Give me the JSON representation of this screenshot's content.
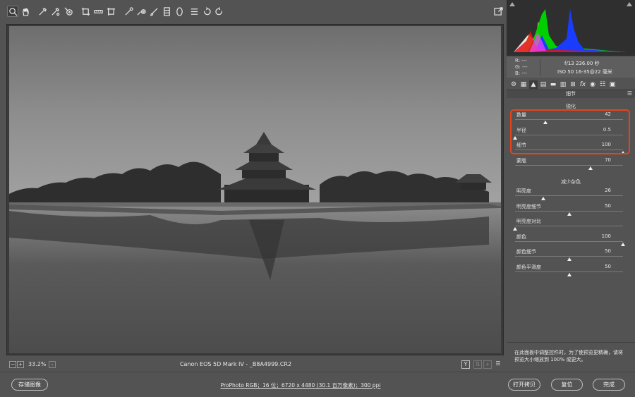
{
  "toolbar": {
    "tools": [
      "zoom-icon",
      "hand-icon",
      "white-balance-icon",
      "color-sampler-icon",
      "target-adjustment-icon",
      "crop-icon",
      "straighten-icon",
      "transform-icon",
      "spot-removal-icon",
      "red-eye-icon",
      "adjustment-brush-icon",
      "graduated-filter-icon",
      "radial-filter-icon",
      "preferences-icon",
      "rotate-ccw-icon",
      "rotate-cw-icon"
    ],
    "right_tool": "fullscreen-toggle-icon"
  },
  "status_bar": {
    "zoom": "33.2%",
    "filename": "Canon EOS 5D Mark IV -  _B8A4999.CR2"
  },
  "info": {
    "r": "R:  ---",
    "g": "G:  ---",
    "b": "B:  ---",
    "aperture_shutter": "f/13    236.00 秒",
    "iso_lens": "ISO 50    16-35@22 毫米"
  },
  "panel": {
    "header": "细节",
    "sharpen": {
      "title": "锐化",
      "amount": {
        "label": "数量",
        "value": "42",
        "level": 0.28
      },
      "radius": {
        "label": "半径",
        "value": "0.5",
        "level": 0.0
      },
      "detail": {
        "label": "细节",
        "value": "100",
        "level": 1.0
      },
      "masking": {
        "label": "蒙版",
        "value": "70",
        "level": 0.7
      }
    },
    "noise": {
      "title": "减少杂色",
      "luminance": {
        "label": "明亮度",
        "value": "26",
        "level": 0.26
      },
      "luminance_detail": {
        "label": "明亮度细节",
        "value": "50",
        "level": 0.5
      },
      "luminance_contrast": {
        "label": "明亮度对比",
        "value": "0",
        "level": 0.0
      },
      "color": {
        "label": "颜色",
        "value": "100",
        "level": 1.0
      },
      "color_detail": {
        "label": "颜色细节",
        "value": "50",
        "level": 0.5
      },
      "color_smoothness": {
        "label": "颜色平滑度",
        "value": "50",
        "level": 0.5
      }
    },
    "hint_line1": "在此面板中调整控件时，为了使预览更精确，请将",
    "hint_line2": "预览大小缩放到 100% 或更大。"
  },
  "footer": {
    "save": "存储图像",
    "workflow": "ProPhoto RGB；16 位；6720 x 4480 (30.1 百万像素)；300 ppi",
    "open_copy": "打开拷贝",
    "reset": "复位",
    "done": "完成"
  },
  "colors": {
    "highlight": "#e8431a",
    "background": "#535353"
  }
}
